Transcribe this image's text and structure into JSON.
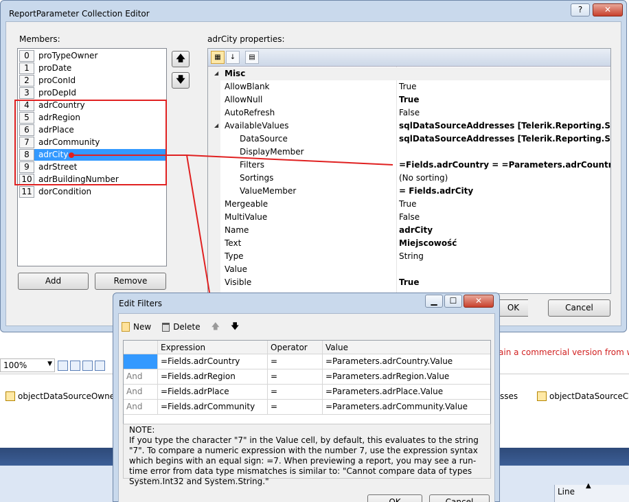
{
  "main_dialog": {
    "title": "ReportParameter Collection Editor",
    "help_glyph": "?",
    "close_glyph": "✕",
    "members_label": "Members:",
    "members": [
      {
        "index": "0",
        "name": "proTypeOwner"
      },
      {
        "index": "1",
        "name": "proDate"
      },
      {
        "index": "2",
        "name": "proConId"
      },
      {
        "index": "3",
        "name": "proDepId"
      },
      {
        "index": "4",
        "name": "adrCountry"
      },
      {
        "index": "5",
        "name": "adrRegion"
      },
      {
        "index": "6",
        "name": "adrPlace"
      },
      {
        "index": "7",
        "name": "adrCommunity"
      },
      {
        "index": "8",
        "name": "adrCity"
      },
      {
        "index": "9",
        "name": "adrStreet"
      },
      {
        "index": "10",
        "name": "adrBuildingNumber"
      },
      {
        "index": "11",
        "name": "dorCondition"
      }
    ],
    "selected_member": "adrCity",
    "move_up_glyph": "🡅",
    "move_down_glyph": "🡇",
    "add_label": "Add",
    "remove_label": "Remove",
    "properties_label": "adrCity properties:",
    "ok_label": "OK",
    "cancel_label": "Cancel",
    "properties": [
      {
        "name": "Misc",
        "value": "",
        "category": true
      },
      {
        "name": "AllowBlank",
        "value": "True",
        "bold": false
      },
      {
        "name": "AllowNull",
        "value": "True",
        "bold": true
      },
      {
        "name": "AutoRefresh",
        "value": "False",
        "bold": false
      },
      {
        "name": "AvailableValues",
        "value": "sqlDataSourceAddresses [Telerik.Reporting.SqlDataSou",
        "bold": true,
        "expanded": true
      },
      {
        "name": "DataSource",
        "value": "sqlDataSourceAddresses [Telerik.Reporting.SqlDataSou",
        "bold": true,
        "sub": true
      },
      {
        "name": "DisplayMember",
        "value": "",
        "bold": false,
        "sub": true
      },
      {
        "name": "Filters",
        "value": "=Fields.adrCountry = =Parameters.adrCountry.Value AN",
        "bold": true,
        "sub": true
      },
      {
        "name": "Sortings",
        "value": "(No sorting)",
        "bold": false,
        "sub": true
      },
      {
        "name": "ValueMember",
        "value": "= Fields.adrCity",
        "bold": true,
        "sub": true
      },
      {
        "name": "Mergeable",
        "value": "True",
        "bold": false
      },
      {
        "name": "MultiValue",
        "value": "False",
        "bold": false
      },
      {
        "name": "Name",
        "value": "adrCity",
        "bold": true
      },
      {
        "name": "Text",
        "value": "Miejscowość",
        "bold": true
      },
      {
        "name": "Type",
        "value": "String",
        "bold": false
      },
      {
        "name": "Value",
        "value": "",
        "bold": false
      },
      {
        "name": "Visible",
        "value": "True",
        "bold": true
      }
    ],
    "toolbar_icons": [
      "categorized-icon",
      "alphabetical-icon",
      "property-pages-icon"
    ]
  },
  "edit_filters": {
    "title": "Edit Filters",
    "new_label": "New",
    "delete_label": "Delete",
    "up_glyph": "🡅",
    "down_glyph": "🡇",
    "columns": [
      "",
      "Expression",
      "Operator",
      "Value"
    ],
    "rows": [
      {
        "logic": "",
        "expression": "=Fields.adrCountry",
        "operator": "=",
        "value": "=Parameters.adrCountry.Value"
      },
      {
        "logic": "And",
        "expression": "=Fields.adrRegion",
        "operator": "=",
        "value": "=Parameters.adrRegion.Value"
      },
      {
        "logic": "And",
        "expression": "=Fields.adrPlace",
        "operator": "=",
        "value": "=Parameters.adrPlace.Value"
      },
      {
        "logic": "And",
        "expression": "=Fields.adrCommunity",
        "operator": "=",
        "value": "=Parameters.adrCommunity.Value"
      }
    ],
    "note_title": "NOTE:",
    "note_text": "If you type the character \"7\" in the Value cell, by default, this evaluates to the string \"7\". To compare a numeric expression with the number 7, use the expression syntax which begins with an equal sign: =7. When previewing a report, you may see a run-time error from data type mismatches is similar to: \"Cannot compare data of types System.Int32 and System.String.\"",
    "ok_label": "OK",
    "cancel_label": "Cancel",
    "minimize_glyph": "▁",
    "maximize_glyph": "☐",
    "close_glyph": "✕"
  },
  "background": {
    "commercial_text": "ain a commercial version from www.",
    "zoom_value": "100%",
    "tray_items": [
      "objectDataSourceOwnerTy",
      "sses",
      "objectDataSourceCond"
    ],
    "status_line_label": "Line"
  },
  "colors": {
    "selection": "#3399ff",
    "annotation_red": "#e02020",
    "dialog_frame": "#c9d9ec"
  }
}
